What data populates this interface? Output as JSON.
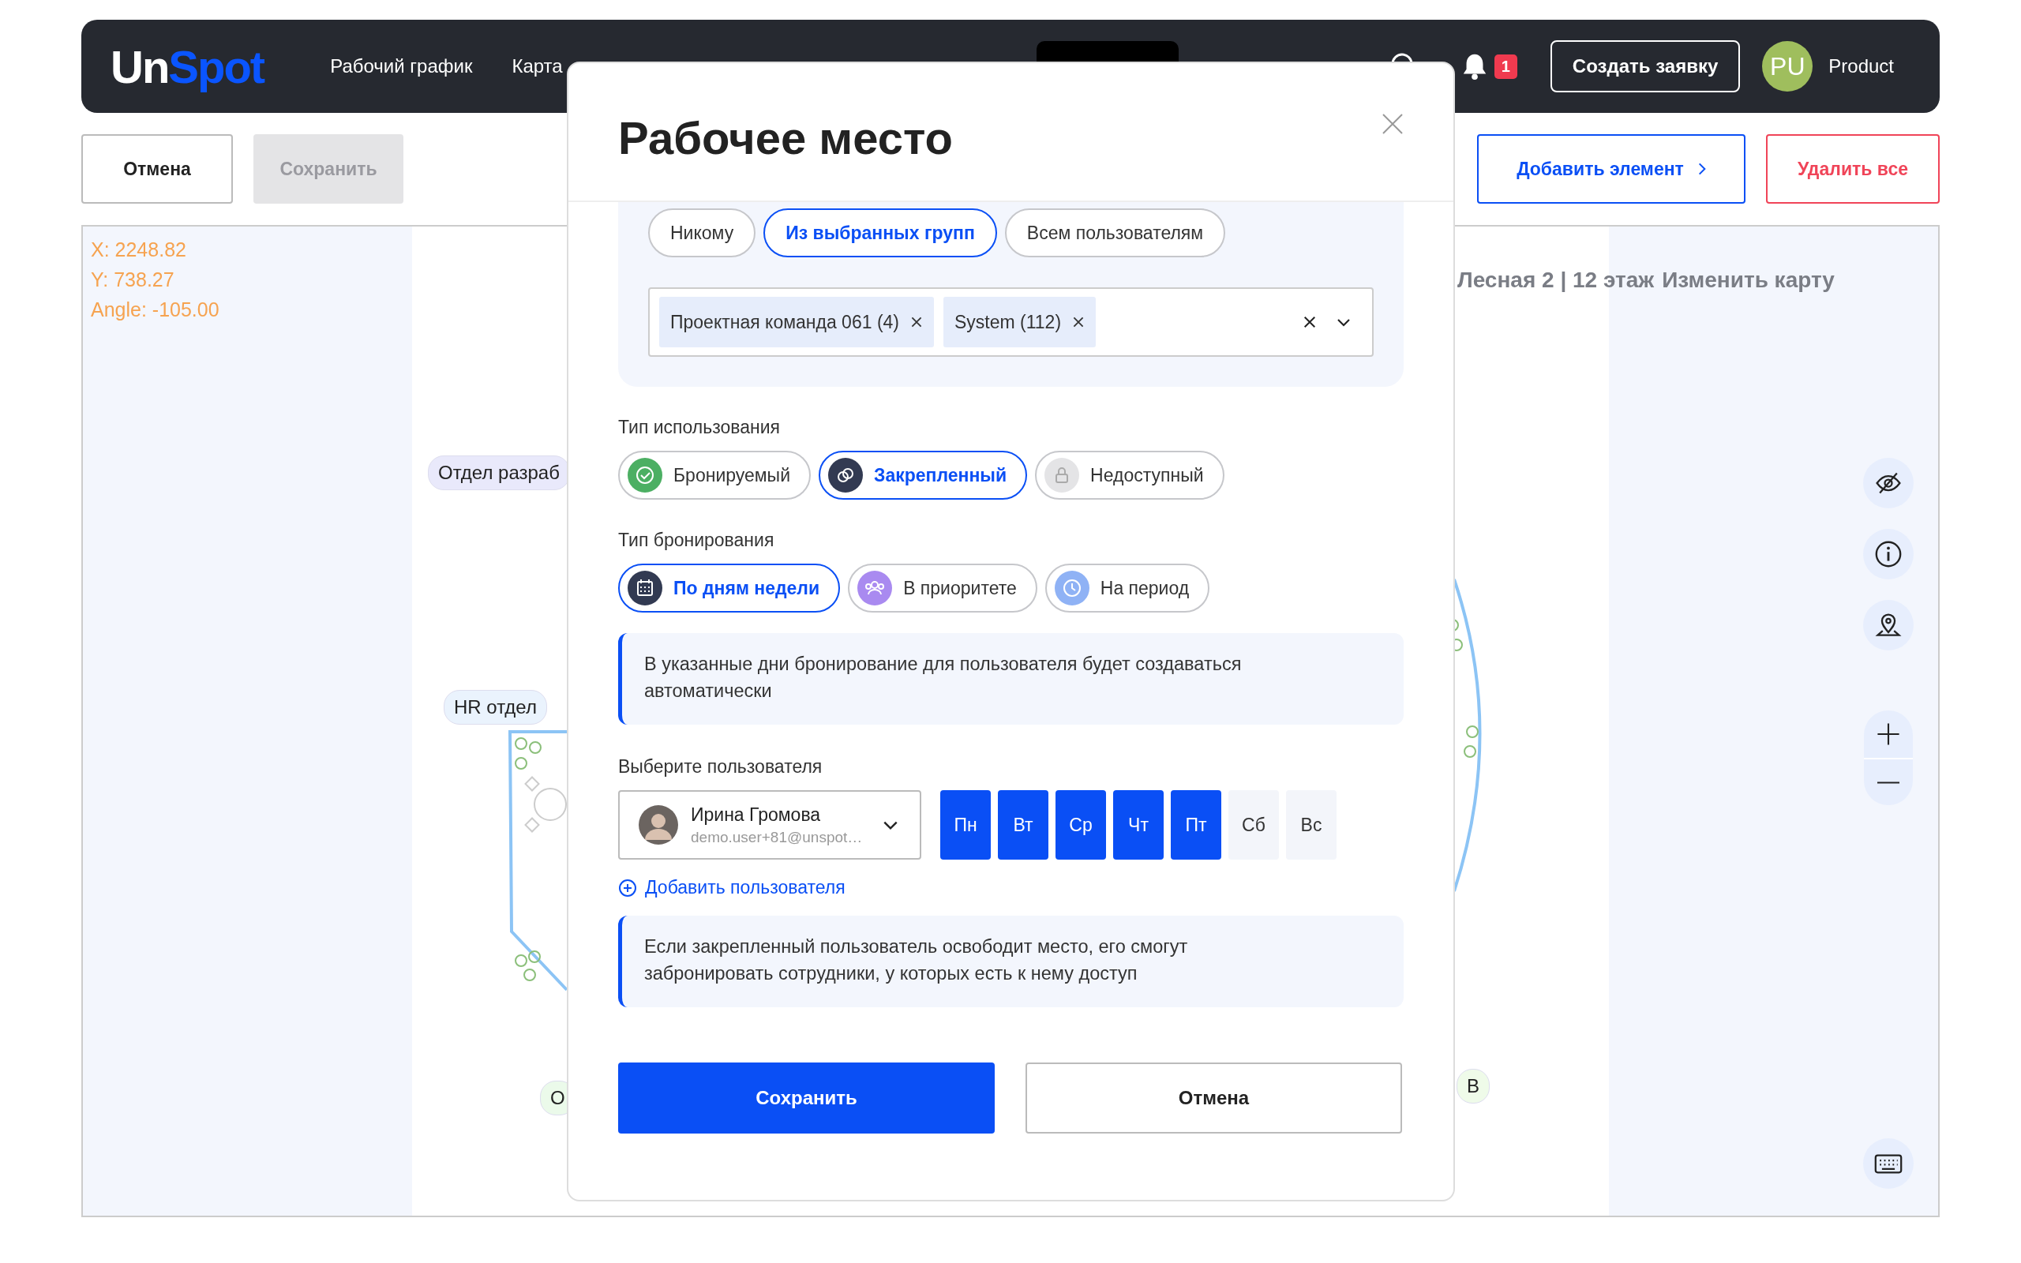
{
  "header": {
    "logo_parts": [
      "Un",
      "Spot"
    ],
    "nav": [
      {
        "label": "Рабочий график",
        "selected": false
      },
      {
        "label": "Карта",
        "selected": false
      }
    ],
    "notification_count": "1",
    "create_button": "Создать заявку",
    "user": {
      "initials": "PU",
      "name": "Product"
    }
  },
  "toolbar": {
    "cancel": "Отмена",
    "save": {
      "label": "Сохранить",
      "disabled": true
    },
    "add": "Добавить элемент",
    "delete": "Удалить все"
  },
  "canvas": {
    "coords": [
      "X: 2248.82",
      "Y: 738.27",
      "Angle: -105.00"
    ],
    "location": "Лесная 2 | 12 этаж",
    "change_map": "Изменить карту",
    "zones": [
      {
        "label": "Отдел разраб",
        "color": "#e9e9fb"
      },
      {
        "label": "HR отдел",
        "color": "#eaf3fd"
      },
      {
        "label": "О",
        "color": "#ebfaea"
      },
      {
        "label": "В",
        "color": "#effbe9"
      }
    ]
  },
  "modal": {
    "title": "Рабочее место",
    "access": [
      {
        "label": "Никому",
        "selected": false
      },
      {
        "label": "Из выбранных групп",
        "selected": true
      },
      {
        "label": "Всем пользователям",
        "selected": false
      }
    ],
    "groups": [
      "Проектная команда 061 (4)",
      "System (112)"
    ],
    "usage_label": "Тип использования",
    "usage": [
      {
        "label": "Бронируемый",
        "kind": "bookable",
        "selected": false
      },
      {
        "label": "Закрепленный",
        "kind": "fixed",
        "selected": true
      },
      {
        "label": "Недоступный",
        "kind": "unavailable",
        "selected": false
      }
    ],
    "booking_label": "Тип бронирования",
    "booking": [
      {
        "label": "По дням недели",
        "kind": "weekdays",
        "selected": true
      },
      {
        "label": "В приоритете",
        "kind": "priority",
        "selected": false
      },
      {
        "label": "На период",
        "kind": "period",
        "selected": false
      }
    ],
    "info_days": "В указанные дни бронирование для пользователя будет создаваться автоматически",
    "user_label": "Выберите пользователя",
    "user": {
      "name": "Ирина Громова",
      "email": "demo.user+81@unspot…"
    },
    "days": [
      {
        "label": "Пн",
        "selected": true
      },
      {
        "label": "Вт",
        "selected": true
      },
      {
        "label": "Ср",
        "selected": true
      },
      {
        "label": "Чт",
        "selected": true
      },
      {
        "label": "Пт",
        "selected": true
      },
      {
        "label": "Сб",
        "selected": false
      },
      {
        "label": "Вс",
        "selected": false
      }
    ],
    "add_user": "Добавить пользователя",
    "info_release": "Если закрепленный пользователь освободит место, его смогут забронировать сотрудники, у которых есть к нему доступ",
    "save": "Сохранить",
    "cancel": "Отмена"
  }
}
